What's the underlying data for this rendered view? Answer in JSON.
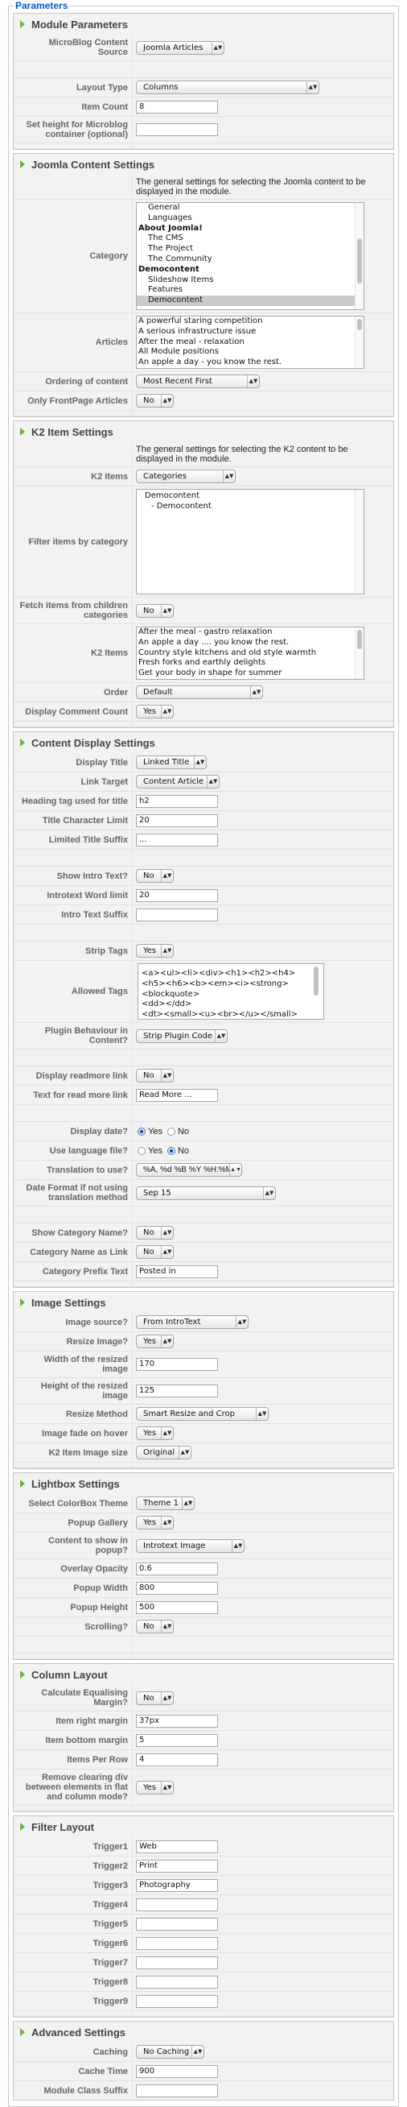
{
  "legend": "Parameters",
  "module_params": {
    "title": "Module Parameters",
    "content_source_label": "MicroBlog Content Source",
    "content_source": "Joomla Articles",
    "layout_type_label": "Layout Type",
    "layout_type": "Columns",
    "item_count_label": "Item Count",
    "item_count": "8",
    "height_label": "Set height for Microblog container (optional)",
    "height": ""
  },
  "joomla": {
    "title": "Joomla Content Settings",
    "description": "The general settings for selecting the Joomla content to be displayed in the module.",
    "category_label": "Category",
    "categories": [
      {
        "label": "General",
        "indent": true,
        "group": false,
        "selected": false
      },
      {
        "label": "Languages",
        "indent": true,
        "group": false,
        "selected": false
      },
      {
        "label": "About Joomla!",
        "indent": false,
        "group": true,
        "selected": false
      },
      {
        "label": "The CMS",
        "indent": true,
        "group": false,
        "selected": false
      },
      {
        "label": "The Project",
        "indent": true,
        "group": false,
        "selected": false
      },
      {
        "label": "The Community",
        "indent": true,
        "group": false,
        "selected": false
      },
      {
        "label": "Democontent",
        "indent": false,
        "group": true,
        "selected": false
      },
      {
        "label": "Slideshow Items",
        "indent": true,
        "group": false,
        "selected": false
      },
      {
        "label": "Features",
        "indent": true,
        "group": false,
        "selected": false
      },
      {
        "label": "Democontent",
        "indent": true,
        "group": false,
        "selected": true
      }
    ],
    "articles_label": "Articles",
    "articles": [
      "A powerful staring competition",
      "A serious infrastructure issue",
      "After the meal - relaxation",
      "All Module positions",
      "An apple a day - you know the rest."
    ],
    "ordering_label": "Ordering of content",
    "ordering": "Most Recent First",
    "frontpage_label": "Only FrontPage Articles",
    "frontpage": "No"
  },
  "k2": {
    "title": "K2 Item Settings",
    "description": "The general settings for selecting the K2 content to be displayed in the module.",
    "items_mode_label": "K2 Items",
    "items_mode": "Categories",
    "filter_label": "Filter items by category",
    "filter_categories": [
      "Democontent",
      "- Democontent"
    ],
    "children_label": "Fetch items from children categories",
    "children": "No",
    "items_label": "K2 Items",
    "items": [
      "After the meal - gastro relaxation",
      "An apple a day .... you know the rest.",
      "Country style kitchens and old style warmth",
      "Fresh forks and earthly delights",
      "Get your body in shape for summer"
    ],
    "order_label": "Order",
    "order": "Default",
    "comment_count_label": "Display Comment Count",
    "comment_count": "Yes"
  },
  "display": {
    "title": "Content Display Settings",
    "display_title_label": "Display Title",
    "display_title": "Linked Title",
    "link_target_label": "Link Target",
    "link_target": "Content Article",
    "heading_tag_label": "Heading tag used for title",
    "heading_tag": "h2",
    "title_limit_label": "Title Character Limit",
    "title_limit": "20",
    "title_suffix_label": "Limited Title Suffix",
    "title_suffix": "...",
    "show_intro_label": "Show Intro Text?",
    "show_intro": "No",
    "intro_limit_label": "Introtext Word limit",
    "intro_limit": "20",
    "intro_suffix_label": "Intro Text Suffix",
    "intro_suffix": "",
    "strip_tags_label": "Strip Tags",
    "strip_tags": "Yes",
    "allowed_tags_label": "Allowed Tags",
    "allowed_tags": [
      "<a><ul><li><div><h1><h2><h4>",
      "<h5><h6><b><em><i><strong>",
      "<blockquote>",
      "<dd></dd>",
      "<dt><small><u><br></u></small>"
    ],
    "plugin_label": "Plugin Behaviour in Content?",
    "plugin": "Strip Plugin Code",
    "readmore_label": "Display readmore link",
    "readmore": "No",
    "readmore_text_label": "Text for read more link",
    "readmore_text": "Read More ...",
    "display_date_label": "Display date?",
    "display_date": "Yes",
    "use_lang_label": "Use language file?",
    "use_lang": "No",
    "yes_label": "Yes",
    "no_label": "No",
    "translation_label": "Translation to use?",
    "translation": "%A, %d %B %Y %H:%M",
    "date_format_label": "Date Format if not using translation method",
    "date_format": "Sep 15",
    "show_cat_label": "Show Category Name?",
    "show_cat": "No",
    "cat_link_label": "Category Name as Link",
    "cat_link": "No",
    "cat_prefix_label": "Category Prefix Text",
    "cat_prefix": "Posted in"
  },
  "image": {
    "title": "Image Settings",
    "source_label": "Image source?",
    "source": "From IntroText",
    "resize_label": "Resize Image?",
    "resize": "Yes",
    "width_label": "Width of the resized image",
    "width": "170",
    "height_label": "Height of the resized image",
    "height": "125",
    "method_label": "Resize Method",
    "method": "Smart Resize and Crop",
    "fade_label": "Image fade on hover",
    "fade": "Yes",
    "k2_size_label": "K2 Item Image size",
    "k2_size": "Original"
  },
  "lightbox": {
    "title": "Lightbox Settings",
    "theme_label": "Select ColorBox Theme",
    "theme": "Theme 1",
    "gallery_label": "Popup Gallery",
    "gallery": "Yes",
    "content_label": "Content to show in popup?",
    "content": "Introtext Image",
    "opacity_label": "Overlay Opacity",
    "opacity": "0.6",
    "width_label": "Popup Width",
    "width": "800",
    "height_label": "Popup Height",
    "height": "500",
    "scrolling_label": "Scrolling?",
    "scrolling": "No"
  },
  "column": {
    "title": "Column Layout",
    "equalise_label": "Calculate Equalising Margin?",
    "equalise": "No",
    "right_margin_label": "Item right margin",
    "right_margin": "37px",
    "bottom_margin_label": "Item bottom margin",
    "bottom_margin": "5",
    "per_row_label": "Items Per Row",
    "per_row": "4",
    "clearing_label": "Remove clearing div between elements in flat and column mode?",
    "clearing": "Yes"
  },
  "filter": {
    "title": "Filter Layout",
    "triggers": [
      {
        "label": "Trigger1",
        "value": "Web"
      },
      {
        "label": "Trigger2",
        "value": "Print"
      },
      {
        "label": "Trigger3",
        "value": "Photography"
      },
      {
        "label": "Trigger4",
        "value": ""
      },
      {
        "label": "Trigger5",
        "value": ""
      },
      {
        "label": "Trigger6",
        "value": ""
      },
      {
        "label": "Trigger7",
        "value": ""
      },
      {
        "label": "Trigger8",
        "value": ""
      },
      {
        "label": "Trigger9",
        "value": ""
      }
    ]
  },
  "advanced": {
    "title": "Advanced Settings",
    "caching_label": "Caching",
    "caching": "No Caching",
    "cache_time_label": "Cache Time",
    "cache_time": "900",
    "suffix_label": "Module Class Suffix",
    "suffix": ""
  }
}
